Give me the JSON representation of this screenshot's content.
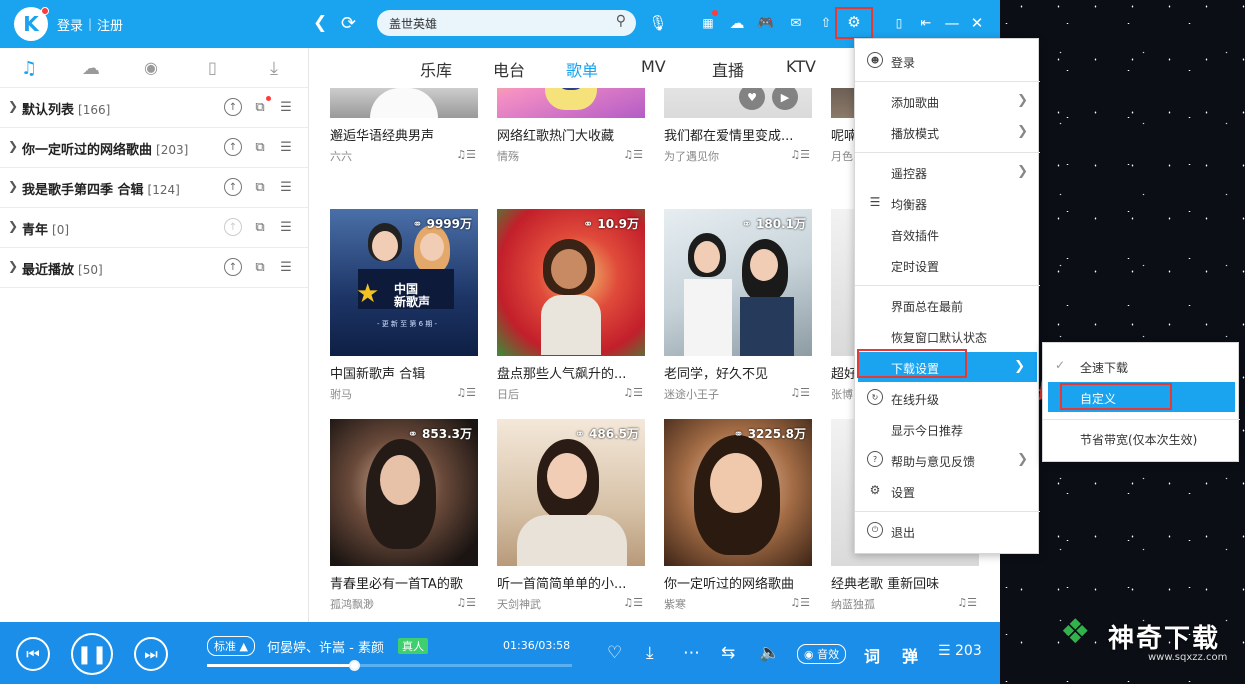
{
  "topbar": {
    "logo": "K",
    "login": "登录",
    "divider": "|",
    "register": "注册",
    "search_value": "盖世英雄"
  },
  "sidebar": {
    "playlists": [
      {
        "name": "默认列表",
        "count": "[166]"
      },
      {
        "name": "你一定听过的网络歌曲",
        "count": "[203]"
      },
      {
        "name": "我是歌手第四季 合辑",
        "count": "[124]"
      },
      {
        "name": "青年",
        "count": "[0]"
      },
      {
        "name": "最近播放",
        "count": "[50]"
      }
    ]
  },
  "main": {
    "tabs": [
      "乐库",
      "电台",
      "歌单",
      "MV",
      "直播",
      "KTV"
    ],
    "active_tab": "歌单",
    "cards": [
      {
        "title": "邂逅华语经典男声",
        "author": "六六",
        "plays": ""
      },
      {
        "title": "网络红歌热门大收藏",
        "author": "情殇",
        "plays": ""
      },
      {
        "title": "我们都在爱情里变成...",
        "author": "为了遇见你",
        "plays": ""
      },
      {
        "title": "呢喃",
        "author": "月色",
        "plays": ""
      },
      {
        "title": "中国新歌声 合辑",
        "author": "驸马",
        "plays": "9999万"
      },
      {
        "title": "盘点那些人气飙升的...",
        "author": "日后",
        "plays": "10.9万"
      },
      {
        "title": "老同学，好久不见",
        "author": "迷途小王子",
        "plays": "180.1万"
      },
      {
        "title": "超好",
        "author": "张博",
        "plays": ""
      },
      {
        "title": "青春里必有一首TA的歌",
        "author": "孤鸿飘渺",
        "plays": "853.3万"
      },
      {
        "title": "听一首简简单单的小...",
        "author": "天剑神武",
        "plays": "486.5万"
      },
      {
        "title": "你一定听过的网络歌曲",
        "author": "紫寒",
        "plays": "3225.8万"
      },
      {
        "title": "经典老歌 重新回味",
        "author": "纳蓝独孤",
        "plays": ""
      }
    ],
    "card2_overlay": {
      "title1": "中国",
      "title2": "新歌声",
      "sub": "- 更 新 至 第 6 期 -"
    }
  },
  "player": {
    "quality": "标准",
    "song": "何晏婷、许嵩 - 素颜",
    "badge": "真人",
    "time": "01:36/03:58",
    "progress": 0.403,
    "effect": "音效",
    "lyrics": "词",
    "danmu": "弹",
    "list_count": "203"
  },
  "menu": {
    "items": [
      "登录",
      "添加歌曲",
      "播放模式",
      "遥控器",
      "均衡器",
      "音效插件",
      "定时设置",
      "界面总在最前",
      "恢复窗口默认状态",
      "下载设置",
      "在线升级",
      "显示今日推荐",
      "帮助与意见反馈",
      "设置",
      "退出"
    ],
    "highlighted": "下载设置"
  },
  "submenu": {
    "items": [
      "全速下载",
      "自定义",
      "节省带宽(仅本次生效)"
    ],
    "highlighted": "自定义"
  },
  "watermark": {
    "text": "神奇下载",
    "url": "www.sqxzz.com"
  },
  "colors": {
    "accent": "#1aa3ef",
    "player": "#1a8ee8",
    "annotation": "#e53935"
  }
}
